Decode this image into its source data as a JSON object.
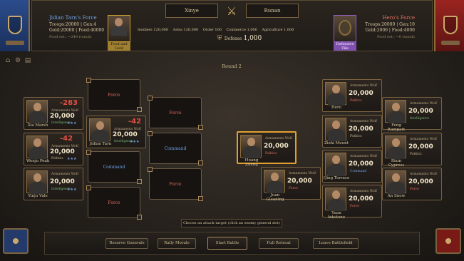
{
  "header": {
    "left_force": {
      "title": "Jidian Tarn's Force",
      "troops": "Troops:20000 | Gen:4",
      "gold_food": "Gold:20000 | Food:40000",
      "food_est": "Food est.: ~249 rounds",
      "portrait_label": "Food and Gold"
    },
    "right_force": {
      "title": "Hero's Force",
      "troops": "Troops:20000 | Gen:10",
      "gold_food": "Gold:2000 | Food:4000",
      "food_est": "Food est.: ~0 rounds",
      "portrait_label": "Defensive Tile"
    },
    "city_left": "Xinye",
    "city_right": "Runan",
    "stats": {
      "soldiers": "Soldiers 120,000",
      "arms": "Arms 120,000",
      "order": "Order 100",
      "commerce": "Commerce 1,000",
      "agriculture": "Agriculture 1,000",
      "defense_label": "Defense",
      "defense_value": "1,000"
    }
  },
  "round": "Round 2",
  "left_generals": [
    {
      "name": "Xia Marsh",
      "label": "Armaments Wolf",
      "troops": "20,000",
      "damage": "-283",
      "trait": "Intelligence",
      "stars": "★★★"
    },
    {
      "name": "Wenju Peak",
      "label": "Armaments Wolf",
      "troops": "20,000",
      "damage": "-42",
      "trait": "Politics",
      "stars": "★★★"
    },
    {
      "name": "Yinju Vale",
      "label": "Armaments Wolf",
      "troops": "20,000",
      "damage": "",
      "trait": "Intelligence",
      "stars": "★★★"
    },
    {
      "name": "Jidian Tarn",
      "label": "Armaments Wolf",
      "troops": "20,000",
      "damage": "-42",
      "trait": "Intelligence",
      "stars": "★★★"
    }
  ],
  "slots_col1": [
    "Force",
    "Command",
    "Force"
  ],
  "slots_col2": [
    "Force",
    "Command",
    "Force"
  ],
  "right_generals": [
    {
      "name": "Huang Zheng",
      "label": "Armaments Wolf",
      "troops": "20,000",
      "trait": "Politics",
      "stars": "★★"
    },
    {
      "name": "Hero",
      "label": "Armaments Wolf",
      "troops": "20,000",
      "trait": "Politics",
      "stars": "★★"
    },
    {
      "name": "Zizhi Mount",
      "label": "Armaments Wolf",
      "troops": "20,000",
      "trait": "Politics",
      "stars": "★★"
    },
    {
      "name": "Qing Terrace",
      "label": "Armaments Wolf",
      "troops": "20,000",
      "trait": "Command",
      "stars": "★★"
    },
    {
      "name": "Juan Gleaning",
      "label": "Armaments Wolf",
      "troops": "20,000",
      "trait": "Force",
      "stars": "★★"
    },
    {
      "name": "Yuan Inkstone",
      "label": "Armaments Wolf",
      "troops": "20,000",
      "trait": "Force",
      "stars": "★★"
    },
    {
      "name": "Feng Rampart",
      "label": "Armaments Wolf",
      "troops": "20,000",
      "trait": "Intelligence",
      "stars": "★★"
    },
    {
      "name": "Rixin Cypress",
      "label": "Armaments Wolf",
      "troops": "20,000",
      "trait": "Politics",
      "stars": "★★"
    },
    {
      "name": "An Snow",
      "label": "Armaments Wolf",
      "troops": "20,000",
      "trait": "Force",
      "stars": "★★"
    }
  ],
  "hint": "Choose an attack target (click an enemy general slot)",
  "buttons": {
    "reserve": "Reserve Generals",
    "rally": "Rally Morale",
    "start": "Start Battle",
    "retreat": "Full Retreat",
    "leave": "Leave Battlefield"
  },
  "colors": {
    "blue_flag": "#2b4c8c",
    "red_flag": "#9b2420",
    "gold_accent": "#c9a86a",
    "highlight": "#e0a030"
  }
}
